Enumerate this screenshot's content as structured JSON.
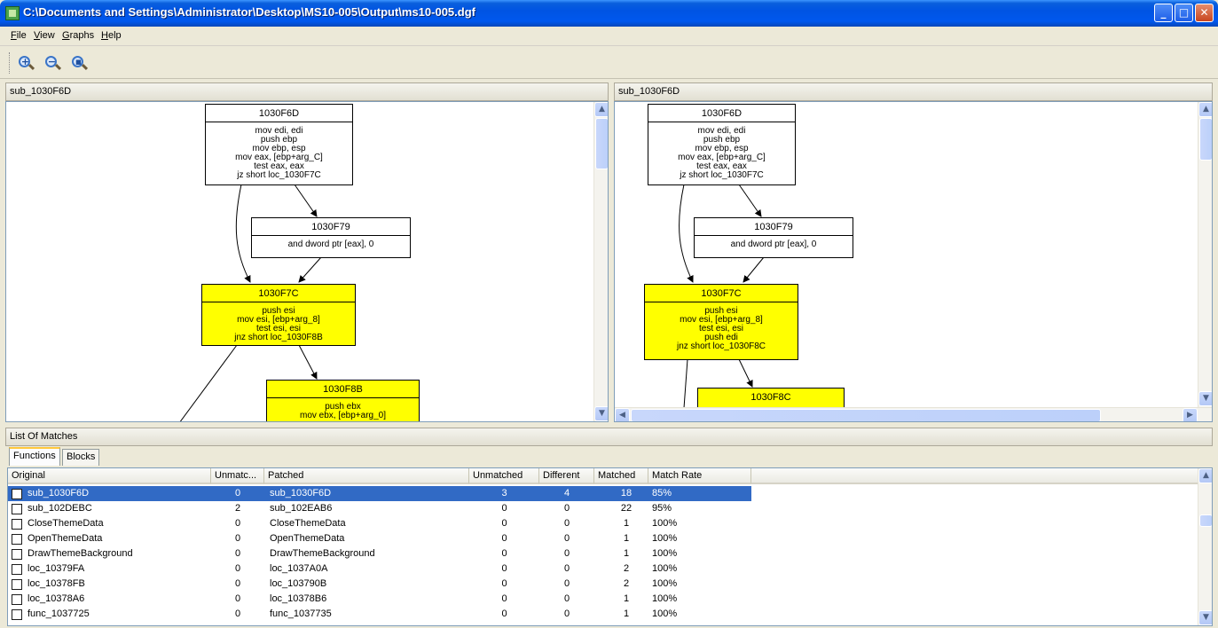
{
  "window": {
    "title": "C:\\Documents and Settings\\Administrator\\Desktop\\MS10-005\\Output\\ms10-005.dgf",
    "controls": {
      "minimize": "_",
      "maximize": "□",
      "close": "✕"
    }
  },
  "menu": [
    "File",
    "View",
    "Graphs",
    "Help"
  ],
  "toolbar": {
    "buttons": [
      {
        "icon": "zoom-in-icon",
        "symbol": "+"
      },
      {
        "icon": "zoom-out-icon",
        "symbol": "−"
      },
      {
        "icon": "zoom-fit-icon",
        "symbol": "▪"
      }
    ]
  },
  "left_pane": {
    "title": "sub_1030F6D",
    "nodes": {
      "n1": {
        "head": "1030F6D",
        "body": "mov edi, edi\npush ebp\nmov ebp, esp\nmov eax, [ebp+arg_C]\ntest eax, eax\njz short loc_1030F7C"
      },
      "n2": {
        "head": "1030F79",
        "body": "and dword ptr [eax], 0"
      },
      "n3": {
        "head": "1030F7C",
        "body": "push esi\nmov esi, [ebp+arg_8]\ntest esi, esi\njnz short loc_1030F8B"
      },
      "n4": {
        "head": "1030F8B",
        "body": "push ebx\nmov ebx, [ebp+arg_0]"
      }
    }
  },
  "right_pane": {
    "title": "sub_1030F6D",
    "nodes": {
      "n1": {
        "head": "1030F6D",
        "body": "mov edi, edi\npush ebp\nmov ebp, esp\nmov eax, [ebp+arg_C]\ntest eax, eax\njz short loc_1030F7C"
      },
      "n2": {
        "head": "1030F79",
        "body": "and dword ptr [eax], 0"
      },
      "n3": {
        "head": "1030F7C",
        "body": "push esi\nmov esi, [ebp+arg_8]\ntest esi, esi\npush edi\njnz short loc_1030F8C"
      },
      "n4": {
        "head": "1030F8C",
        "body": ""
      }
    }
  },
  "colors": {
    "matched_block": "#ffff00",
    "selection": "#316ac5"
  },
  "matches": {
    "title": "List Of Matches",
    "tabs": [
      "Functions",
      "Blocks"
    ],
    "columns": [
      "Original",
      "Unmatc...",
      "Patched",
      "Unmatched",
      "Different",
      "Matched",
      "Match Rate"
    ],
    "rows": [
      {
        "original": "sub_1030F6D",
        "unmatched_orig": "0",
        "patched": "sub_1030F6D",
        "unmatched": "3",
        "different": "4",
        "matched": "18",
        "rate": "85%",
        "selected": true
      },
      {
        "original": "sub_102DEBC",
        "unmatched_orig": "2",
        "patched": "sub_102EAB6",
        "unmatched": "0",
        "different": "0",
        "matched": "22",
        "rate": "95%"
      },
      {
        "original": "CloseThemeData",
        "unmatched_orig": "0",
        "patched": "CloseThemeData",
        "unmatched": "0",
        "different": "0",
        "matched": "1",
        "rate": "100%"
      },
      {
        "original": "OpenThemeData",
        "unmatched_orig": "0",
        "patched": "OpenThemeData",
        "unmatched": "0",
        "different": "0",
        "matched": "1",
        "rate": "100%"
      },
      {
        "original": "DrawThemeBackground",
        "unmatched_orig": "0",
        "patched": "DrawThemeBackground",
        "unmatched": "0",
        "different": "0",
        "matched": "1",
        "rate": "100%"
      },
      {
        "original": "loc_10379FA",
        "unmatched_orig": "0",
        "patched": "loc_1037A0A",
        "unmatched": "0",
        "different": "0",
        "matched": "2",
        "rate": "100%"
      },
      {
        "original": "loc_10378FB",
        "unmatched_orig": "0",
        "patched": "loc_103790B",
        "unmatched": "0",
        "different": "0",
        "matched": "2",
        "rate": "100%"
      },
      {
        "original": "loc_10378A6",
        "unmatched_orig": "0",
        "patched": "loc_10378B6",
        "unmatched": "0",
        "different": "0",
        "matched": "1",
        "rate": "100%"
      },
      {
        "original": "func_1037725",
        "unmatched_orig": "0",
        "patched": "func_1037735",
        "unmatched": "0",
        "different": "0",
        "matched": "1",
        "rate": "100%"
      }
    ]
  }
}
